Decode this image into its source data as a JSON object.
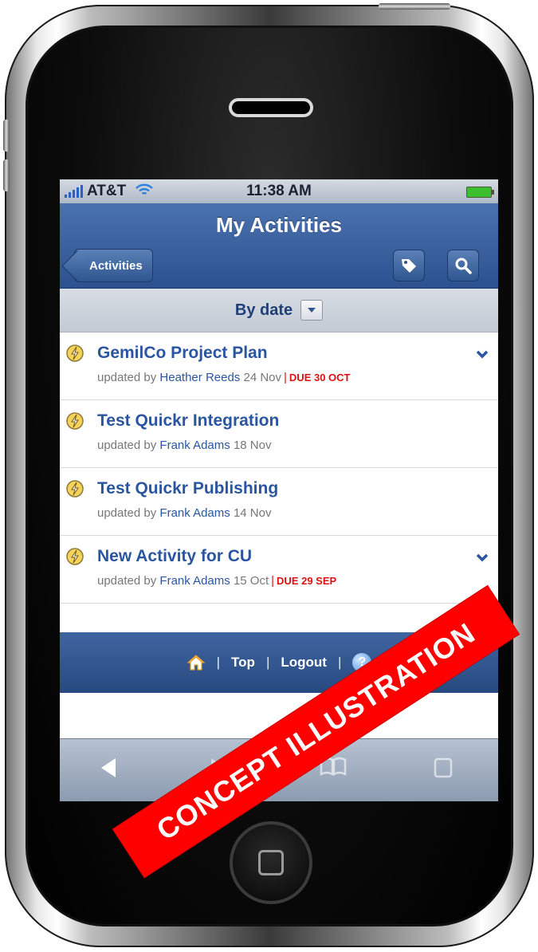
{
  "status_bar": {
    "carrier": "AT&T",
    "time": "11:38 AM"
  },
  "nav": {
    "title": "My Activities",
    "back_label": "Activities"
  },
  "sort": {
    "label": "By date"
  },
  "activities": [
    {
      "title": "GemilCo Project Plan",
      "updated_prefix": "updated by",
      "who": "Heather Reeds",
      "date": "24 Nov",
      "sep": "|",
      "due": "DUE 30 OCT"
    },
    {
      "title": "Test Quickr Integration",
      "updated_prefix": "updated by",
      "who": "Frank Adams",
      "date": "18 Nov",
      "sep": "",
      "due": ""
    },
    {
      "title": "Test Quickr Publishing",
      "updated_prefix": "updated by",
      "who": "Frank Adams",
      "date": "14 Nov",
      "sep": "",
      "due": ""
    },
    {
      "title": "New Activity for CU",
      "updated_prefix": "updated by",
      "who": "Frank Adams",
      "date": "15 Oct",
      "sep": "|",
      "due": "DUE 29 SEP"
    }
  ],
  "footer": {
    "top": "Top",
    "logout": "Logout",
    "pipe1": "|",
    "pipe2": "|",
    "pipe3": "|"
  },
  "watermark": "CONCEPT ILLUSTRATION",
  "colors": {
    "nav_blue": "#2c5191",
    "link_blue": "#2a55a0",
    "due_red": "#dd1111",
    "stamp_red": "#ff0000"
  }
}
